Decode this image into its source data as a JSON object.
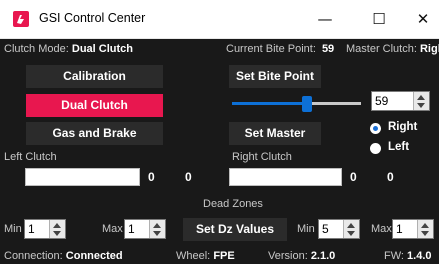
{
  "window": {
    "title": "GSI Control Center",
    "controls": {
      "minimize": "—",
      "maximize": "☐",
      "close": "✕"
    }
  },
  "status": {
    "clutch_mode_label": "Clutch Mode:",
    "clutch_mode_value": "Dual Clutch",
    "bite_point_label": "Current Bite Point:",
    "bite_point_value": "59",
    "master_clutch_label": "Master Clutch:",
    "master_clutch_value": "Right"
  },
  "buttons": {
    "calibration": "Calibration",
    "dual_clutch": "Dual Clutch",
    "gas_and_brake": "Gas and Brake",
    "set_bite_point": "Set Bite Point",
    "set_master": "Set Master",
    "set_dz_values": "Set Dz Values"
  },
  "bite_slider": {
    "value": 59,
    "min": 0,
    "max": 100
  },
  "bite_spinner": {
    "value": "59"
  },
  "master_radio": {
    "right_label": "Right",
    "left_label": "Left",
    "selected": "right"
  },
  "left_clutch": {
    "label": "Left Clutch",
    "value_a": "0",
    "value_b": "0",
    "progress": 0
  },
  "right_clutch": {
    "label": "Right Clutch",
    "value_a": "0",
    "value_b": "0",
    "progress": 0
  },
  "dead_zones": {
    "title": "Dead Zones",
    "left_min_label": "Min",
    "left_min_value": "1",
    "left_max_label": "Max",
    "left_max_value": "1",
    "right_min_label": "Min",
    "right_min_value": "5",
    "right_max_label": "Max",
    "right_max_value": "1"
  },
  "footer": {
    "connection_label": "Connection:",
    "connection_value": "Connected",
    "wheel_label": "Wheel:",
    "wheel_value": "FPE",
    "version_label": "Version:",
    "version_value": "2.1.0",
    "fw_label": "FW:",
    "fw_value": "1.4.0"
  },
  "colors": {
    "accent": "#e8174f",
    "background": "#191919",
    "button": "#2b2b2b",
    "slider": "#0d70d6"
  },
  "icons": {
    "app": "gsi-logo-icon",
    "minimize": "minimize-icon",
    "maximize": "maximize-icon",
    "close": "close-icon"
  }
}
